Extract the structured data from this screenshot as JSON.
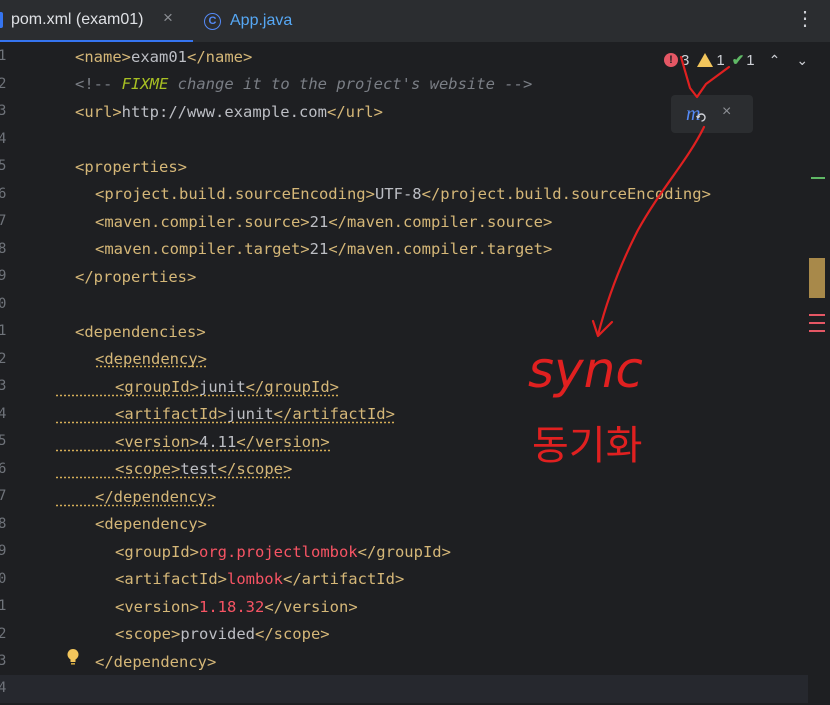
{
  "tabs": [
    {
      "label": "pom.xml (exam01)",
      "close": "×",
      "active": true
    },
    {
      "label": "App.java",
      "icon": "java-class-icon",
      "icon_glyph": "C",
      "active": false
    }
  ],
  "menu_glyph": "⋮",
  "gutter": [
    "1",
    "2",
    "3",
    "4",
    "5",
    "6",
    "7",
    "8",
    "9",
    "0",
    "1",
    "2",
    "3",
    "4",
    "5",
    "6",
    "7",
    "8",
    "9",
    "0",
    "1",
    "2",
    "3",
    "4"
  ],
  "inspections": {
    "errors": "3",
    "warnings": "1",
    "ok": "1",
    "error_glyph": "!",
    "ok_glyph": "✔",
    "prev": "⌃",
    "next": "⌄"
  },
  "maven_popup": {
    "icon": "m",
    "close": "×"
  },
  "code": {
    "l1": {
      "open": "<name>",
      "value": "exam01",
      "close": "</name>"
    },
    "l2": {
      "start": "<!-- ",
      "fixme": "FIXME",
      "rest": " change it to the project's website -->"
    },
    "l3": {
      "open": "<url>",
      "value": "http://www.example.com",
      "close": "</url>"
    },
    "l5": "<properties>",
    "l6": {
      "open": "<project.build.sourceEncoding>",
      "value": "UTF-8",
      "close": "</project.build.sourceEncoding>"
    },
    "l7": {
      "open": "<maven.compiler.source>",
      "value": "21",
      "close": "</maven.compiler.source>"
    },
    "l8": {
      "open": "<maven.compiler.target>",
      "value": "21",
      "close": "</maven.compiler.target>"
    },
    "l9": "</properties>",
    "l11": "<dependencies>",
    "l12": "<dependency>",
    "l13": {
      "open": "<groupId>",
      "value": "junit",
      "close": "</groupId>"
    },
    "l14": {
      "open": "<artifactId>",
      "value": "junit",
      "close": "</artifactId>"
    },
    "l15": {
      "open": "<version>",
      "value": "4.11",
      "close": "</version>"
    },
    "l16": {
      "open": "<scope>",
      "value": "test",
      "close": "</scope>"
    },
    "l17": "</dependency>",
    "l18": "<dependency>",
    "l19": {
      "open": "<groupId>",
      "value": "org.projectlombok",
      "close": "</groupId>"
    },
    "l20": {
      "open": "<artifactId>",
      "value": "lombok",
      "close": "</artifactId>"
    },
    "l21": {
      "open": "<version>",
      "value": "1.18.32",
      "close": "</version>"
    },
    "l22": {
      "open": "<scope>",
      "value": "provided",
      "close": "</scope>"
    },
    "l23": "</dependency>"
  },
  "annotation": {
    "word": "sync",
    "korean": "동기화"
  },
  "colors": {
    "background": "#1e1f22",
    "tag": "#d5b778",
    "comment": "#7a7e85",
    "fixme": "#a8c023",
    "error_value": "#f75464",
    "annotation": "#e02020",
    "accent": "#3574f0"
  }
}
